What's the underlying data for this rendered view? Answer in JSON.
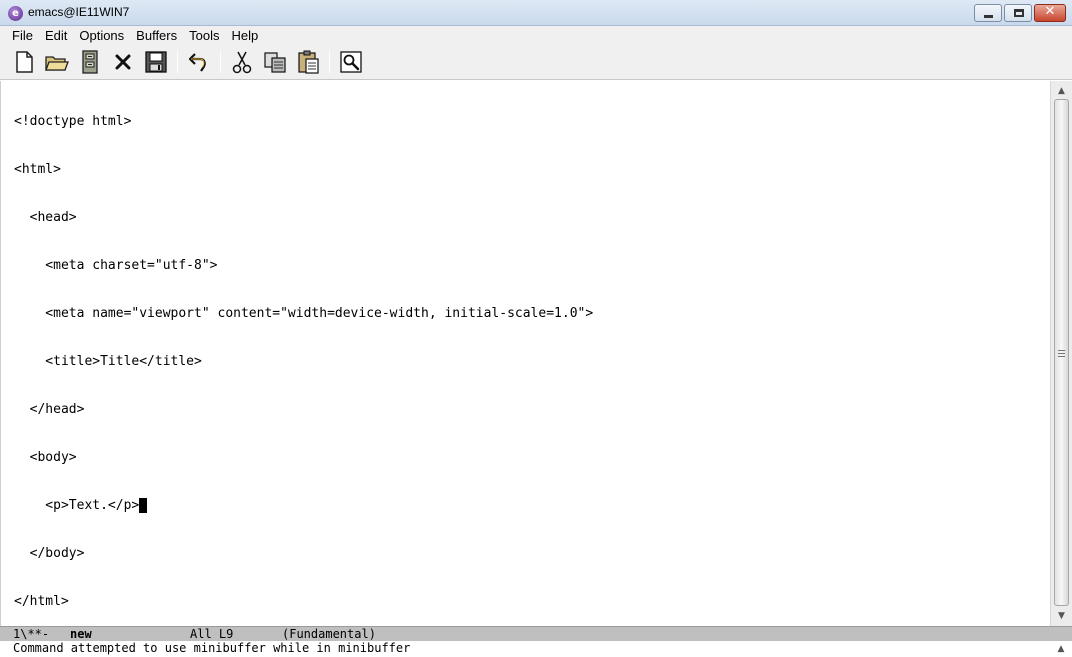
{
  "window": {
    "title": "emacs@IE11WIN7",
    "app_icon_glyph": "e",
    "close_glyph": "✕"
  },
  "menu": {
    "items": [
      "File",
      "Edit",
      "Options",
      "Buffers",
      "Tools",
      "Help"
    ]
  },
  "toolbar": {
    "icons": [
      "new-file-icon",
      "open-folder-icon",
      "open-directory-icon",
      "close-buffer-icon",
      "save-icon",
      "undo-icon",
      "cut-icon",
      "copy-icon",
      "paste-icon",
      "search-icon"
    ]
  },
  "editor": {
    "lines": [
      "<!doctype html>",
      "<html>",
      "  <head>",
      "    <meta charset=\"utf-8\">",
      "    <meta name=\"viewport\" content=\"width=device-width, initial-scale=1.0\">",
      "    <title>Title</title>",
      "  </head>",
      "  <body>",
      "    <p>Text.</p>",
      "  </body>",
      "</html>"
    ],
    "cursor_line": 9
  },
  "modeline": {
    "status": "1\\**-",
    "buffer_name": "new",
    "position": "All L9",
    "mode": "(Fundamental)"
  },
  "echo": {
    "message": "Command attempted to use minibuffer while in minibuffer"
  },
  "colors": {
    "modeline_bg": "#bfbfbf",
    "menubar_bg": "#f0f0f0",
    "close_button": "#c8452d"
  }
}
